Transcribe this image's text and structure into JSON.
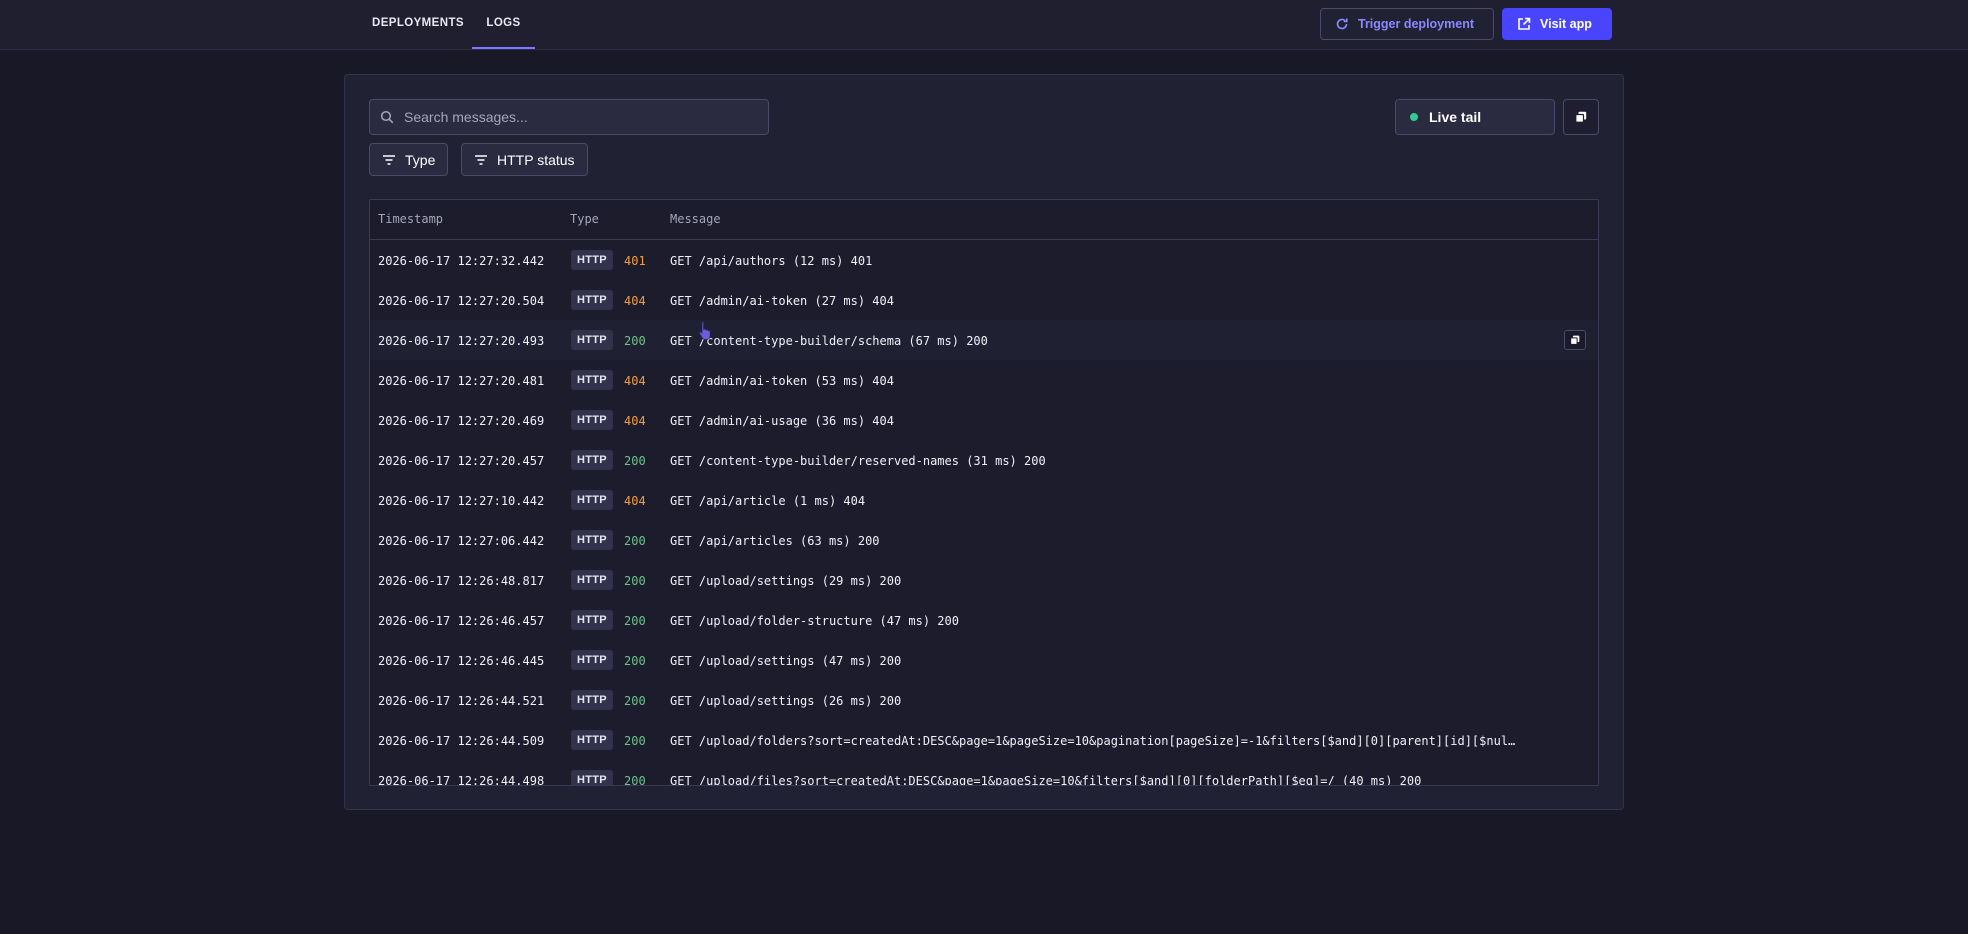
{
  "nav": {
    "tabs": [
      {
        "label": "DEPLOYMENTS"
      },
      {
        "label": "LOGS",
        "active": true
      }
    ],
    "trigger_label": "Trigger deployment",
    "visit_label": "Visit app"
  },
  "logs": {
    "search_placeholder": "Search messages...",
    "filters": [
      {
        "label": "Type",
        "icon": "filter-icon"
      },
      {
        "label": "HTTP status",
        "icon": "filter-icon"
      }
    ],
    "live_tail_label": "Live tail",
    "columns": {
      "timestamp": "Timestamp",
      "type": "Type",
      "message": "Message"
    },
    "rows": [
      {
        "timestamp": "2026-06-17 12:27:32.442",
        "type": "HTTP",
        "status": "401",
        "message": "GET /api/authors (12 ms) 401"
      },
      {
        "timestamp": "2026-06-17 12:27:20.504",
        "type": "HTTP",
        "status": "404",
        "message": "GET /admin/ai-token (27 ms) 404"
      },
      {
        "timestamp": "2026-06-17 12:27:20.493",
        "type": "HTTP",
        "status": "200",
        "message": "GET /content-type-builder/schema (67 ms) 200"
      },
      {
        "timestamp": "2026-06-17 12:27:20.481",
        "type": "HTTP",
        "status": "404",
        "message": "GET /admin/ai-token (53 ms) 404"
      },
      {
        "timestamp": "2026-06-17 12:27:20.469",
        "type": "HTTP",
        "status": "404",
        "message": "GET /admin/ai-usage (36 ms) 404"
      },
      {
        "timestamp": "2026-06-17 12:27:20.457",
        "type": "HTTP",
        "status": "200",
        "message": "GET /content-type-builder/reserved-names (31 ms) 200"
      },
      {
        "timestamp": "2026-06-17 12:27:10.442",
        "type": "HTTP",
        "status": "404",
        "message": "GET /api/article (1 ms) 404"
      },
      {
        "timestamp": "2026-06-17 12:27:06.442",
        "type": "HTTP",
        "status": "200",
        "message": "GET /api/articles (63 ms) 200"
      },
      {
        "timestamp": "2026-06-17 12:26:48.817",
        "type": "HTTP",
        "status": "200",
        "message": "GET /upload/settings (29 ms) 200"
      },
      {
        "timestamp": "2026-06-17 12:26:46.457",
        "type": "HTTP",
        "status": "200",
        "message": "GET /upload/folder-structure (47 ms) 200"
      },
      {
        "timestamp": "2026-06-17 12:26:46.445",
        "type": "HTTP",
        "status": "200",
        "message": "GET /upload/settings (47 ms) 200"
      },
      {
        "timestamp": "2026-06-17 12:26:44.521",
        "type": "HTTP",
        "status": "200",
        "message": "GET /upload/settings (26 ms) 200"
      },
      {
        "timestamp": "2026-06-17 12:26:44.509",
        "type": "HTTP",
        "status": "200",
        "message": "GET /upload/folders?sort=createdAt:DESC&page=1&pageSize=10&pagination[pageSize]=-1&filters[$and][0][parent][id][$nul…"
      },
      {
        "timestamp": "2026-06-17 12:26:44.498",
        "type": "HTTP",
        "status": "200",
        "message": "GET /upload/files?sort=createdAt:DESC&page=1&pageSize=10&filters[$and][0][folderPath][$eq]=/ (40 ms) 200"
      }
    ]
  },
  "colors": {
    "background": "#181826",
    "panel": "#212134",
    "accent": "#4945ff",
    "status_ok": "#6cc18a",
    "status_warn": "#f29d41",
    "live_dot": "#2ecc8f"
  }
}
